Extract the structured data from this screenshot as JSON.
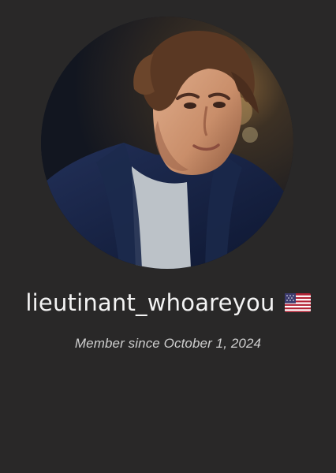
{
  "profile": {
    "username": "lieutinant_whoareyou",
    "member_since": "Member since October 1, 2024",
    "avatar_icon": "profile-photo",
    "flag_icon": "us-flag-icon"
  },
  "colors": {
    "background": "#292828",
    "username_text": "#f4f4f4",
    "subtitle_text": "#cfcfcf"
  }
}
